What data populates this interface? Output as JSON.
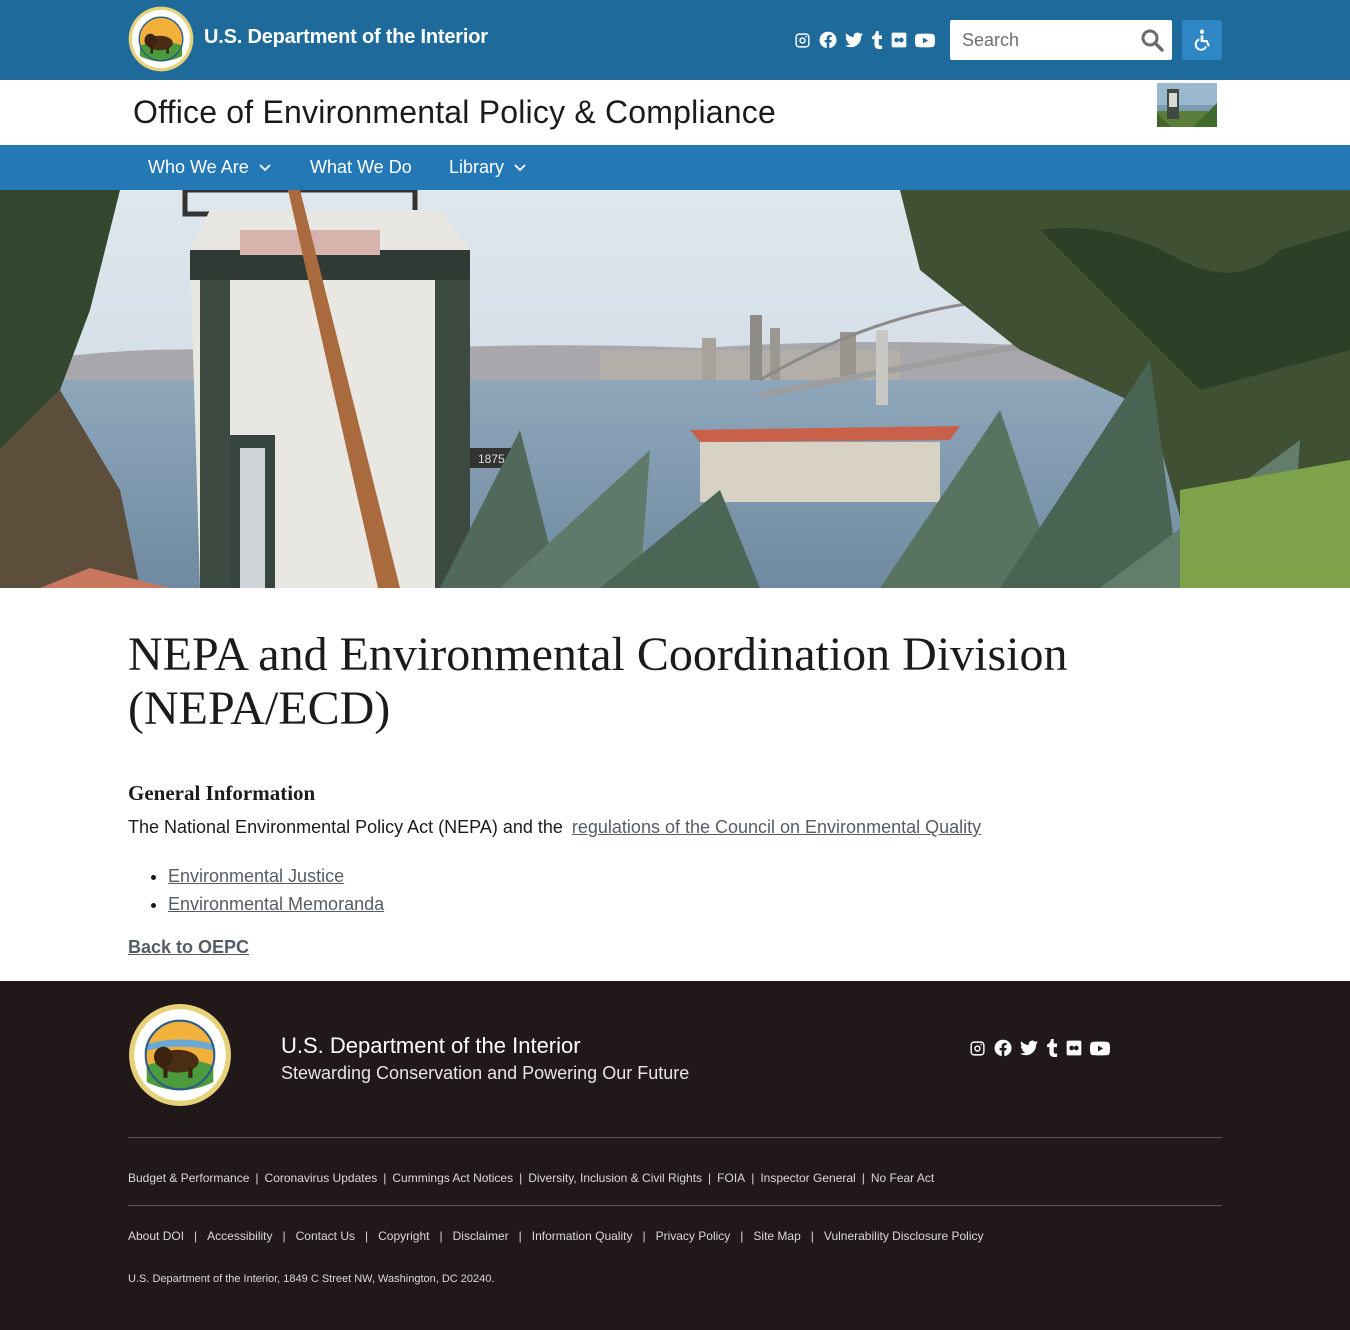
{
  "header": {
    "department_title": "U.S. Department of the Interior",
    "social_icons": [
      "instagram-icon",
      "facebook-icon",
      "twitter-icon",
      "tumblr-icon",
      "flickr-icon",
      "youtube-icon"
    ],
    "search": {
      "placeholder": "Search",
      "value": ""
    },
    "colors": {
      "topbar": "#1e6a9b",
      "nav": "#2378b5",
      "accessibility_button": "#2f88c5"
    }
  },
  "office": {
    "title": "Office of Environmental Policy & Compliance"
  },
  "nav": {
    "items": [
      {
        "label": "Who We Are",
        "has_dropdown": true
      },
      {
        "label": "What We Do",
        "has_dropdown": false
      },
      {
        "label": "Library",
        "has_dropdown": true
      }
    ]
  },
  "main": {
    "page_title": "NEPA and Environmental Coordination Division (NEPA/ECD)",
    "section_heading": "General Information",
    "intro_text": "The National Environmental Policy Act (NEPA) and the",
    "intro_link": "regulations of the Council on Environmental Quality",
    "links": [
      "Environmental Justice",
      "Environmental Memoranda"
    ],
    "back_link": "Back to OEPC",
    "link_color": "#565c65"
  },
  "footer": {
    "title": "U.S. Department of the Interior",
    "subtitle": "Stewarding Conservation and Powering Our Future",
    "row1_links": [
      "Budget & Performance",
      "Coronavirus Updates",
      "Cummings Act Notices",
      "Diversity, Inclusion & Civil Rights",
      "FOIA",
      "Inspector General",
      "No Fear Act"
    ],
    "row2_links": [
      "About DOI",
      "Accessibility",
      "Contact Us",
      "Copyright",
      "Disclaimer",
      "Information Quality",
      "Privacy Policy",
      "Site Map",
      "Vulnerability Disclosure Policy"
    ],
    "separator": "|",
    "address": "U.S. Department of the Interior, 1849 C Street NW, Washington, DC 20240.",
    "background": "#211819"
  }
}
